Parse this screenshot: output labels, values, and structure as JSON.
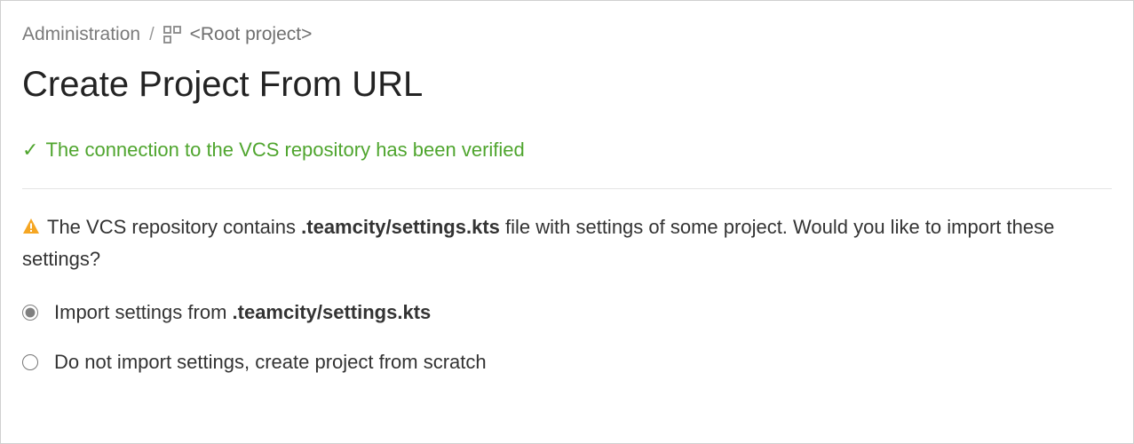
{
  "breadcrumb": {
    "admin_label": "Administration",
    "separator": "/",
    "root_label": "<Root project>"
  },
  "page_title": "Create Project From URL",
  "success": {
    "check_glyph": "✓",
    "message": "The connection to the VCS repository has been verified"
  },
  "info": {
    "prefix": "The VCS repository contains ",
    "file_path": ".teamcity/settings.kts",
    "suffix": " file with settings of some project. Would you like to import these settings?"
  },
  "options": {
    "import": {
      "prefix": "Import settings from ",
      "file_path": ".teamcity/settings.kts",
      "selected": true
    },
    "scratch": {
      "label": "Do not import settings, create project from scratch",
      "selected": false
    }
  }
}
